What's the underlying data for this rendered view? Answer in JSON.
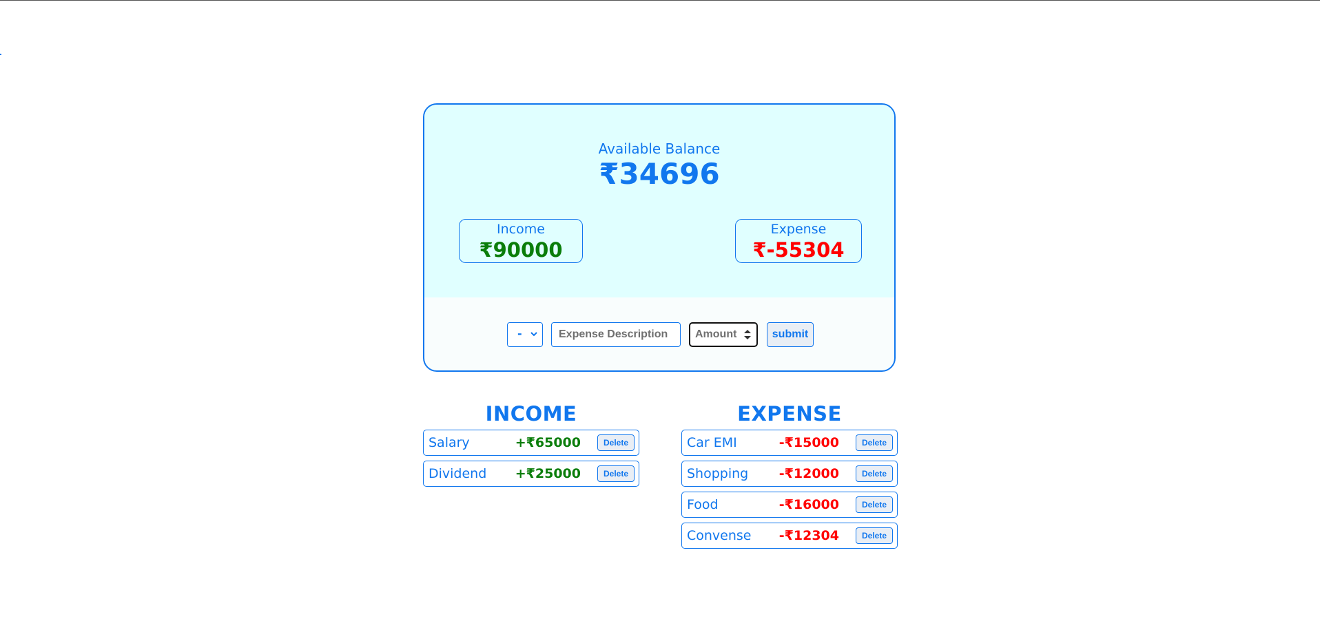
{
  "balance": {
    "label": "Available Balance",
    "value": "₹34696"
  },
  "summary": {
    "income_label": "Income",
    "income_value": "₹90000",
    "expense_label": "Expense",
    "expense_value": "₹-55304"
  },
  "form": {
    "type_selected": "-",
    "description_placeholder": "Expense Description",
    "amount_placeholder": "Amount",
    "submit_label": "submit"
  },
  "income_list": {
    "heading": "INCOME",
    "items": [
      {
        "description": "Salary",
        "amount": "+₹65000",
        "delete_label": "Delete"
      },
      {
        "description": "Dividend",
        "amount": "+₹25000",
        "delete_label": "Delete"
      }
    ]
  },
  "expense_list": {
    "heading": "EXPENSE",
    "items": [
      {
        "description": "Car EMI",
        "amount": "-₹15000",
        "delete_label": "Delete"
      },
      {
        "description": "Shopping",
        "amount": "-₹12000",
        "delete_label": "Delete"
      },
      {
        "description": "Food",
        "amount": "-₹16000",
        "delete_label": "Delete"
      },
      {
        "description": "Convense",
        "amount": "-₹12304",
        "delete_label": "Delete"
      }
    ]
  },
  "colors": {
    "accent": "#1177ee",
    "income": "#0a7d0a",
    "expense": "#ff0000",
    "card_top_bg": "#e0ffff"
  },
  "icons": {
    "select_chevron": "chevron-down-icon",
    "amount_spinner": "spinner-arrows-icon"
  }
}
